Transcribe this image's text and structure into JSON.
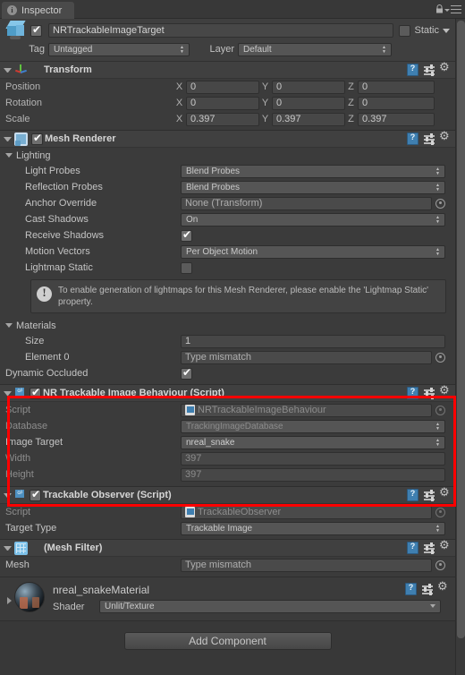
{
  "window": {
    "tab_label": "Inspector",
    "tab_icon": "info-icon",
    "lock_icon": "lock-icon",
    "menu_icon": "hamburger-menu-icon"
  },
  "object_header": {
    "icon": "cube-prefab-icon",
    "enabled": true,
    "name": "NRTrackableImageTarget",
    "static_label": "Static",
    "static_checked": false,
    "tag_label": "Tag",
    "tag_value": "Untagged",
    "layer_label": "Layer",
    "layer_value": "Default"
  },
  "components": [
    {
      "title": "Transform",
      "icon": "transform-axis-icon",
      "has_checkbox": false,
      "rows": [
        {
          "label": "Position",
          "x": "0",
          "y": "0",
          "z": "0"
        },
        {
          "label": "Rotation",
          "x": "0",
          "y": "0",
          "z": "0"
        },
        {
          "label": "Scale",
          "x": "0.397",
          "y": "0.397",
          "z": "0.397"
        }
      ],
      "axis_labels": {
        "x": "X",
        "y": "Y",
        "z": "Z"
      }
    },
    {
      "title": "Mesh Renderer",
      "icon": "mesh-renderer-icon",
      "has_checkbox": true,
      "checked": true,
      "lighting_label": "Lighting",
      "lighting_rows": [
        {
          "label": "Light Probes",
          "value": "Blend Probes",
          "kind": "popup"
        },
        {
          "label": "Reflection Probes",
          "value": "Blend Probes",
          "kind": "popup"
        },
        {
          "label": "Anchor Override",
          "value": "None (Transform)",
          "kind": "object"
        },
        {
          "label": "Cast Shadows",
          "value": "On",
          "kind": "popup"
        },
        {
          "label": "Receive Shadows",
          "value": "",
          "kind": "checkbox",
          "checked": true
        },
        {
          "label": "Motion Vectors",
          "value": "Per Object Motion",
          "kind": "popup"
        },
        {
          "label": "Lightmap Static",
          "value": "",
          "kind": "checkbox",
          "checked": false
        }
      ],
      "helpbox": "To enable generation of lightmaps for this Mesh Renderer, please enable the 'Lightmap Static' property.",
      "helpbox_icon": "warning-icon",
      "materials_label": "Materials",
      "material_rows": [
        {
          "label": "Size",
          "value": "1",
          "kind": "text"
        },
        {
          "label": "Element 0",
          "value": "Type mismatch",
          "kind": "object"
        }
      ],
      "dynamic_occluded": {
        "label": "Dynamic Occluded",
        "checked": true
      }
    },
    {
      "title": "NR Trackable Image Behaviour (Script)",
      "icon": "csharp-script-icon",
      "has_checkbox": true,
      "checked": true,
      "highlighted": true,
      "rows": [
        {
          "label": "Script",
          "value": "NRTrackableImageBehaviour",
          "kind": "script",
          "dim": true
        },
        {
          "label": "Database",
          "value": "TrackingImageDatabase",
          "kind": "popup",
          "dim": true
        },
        {
          "label": "Image Target",
          "value": "nreal_snake",
          "kind": "popup",
          "dim": false
        },
        {
          "label": "Width",
          "value": "397",
          "kind": "text",
          "dim": true
        },
        {
          "label": "Height",
          "value": "397",
          "kind": "text",
          "dim": true
        }
      ]
    },
    {
      "title": "Trackable Observer (Script)",
      "icon": "csharp-script-icon",
      "has_checkbox": true,
      "checked": true,
      "rows": [
        {
          "label": "Script",
          "value": "TrackableObserver",
          "kind": "script",
          "dim": true
        },
        {
          "label": "Target Type",
          "value": "Trackable Image",
          "kind": "popup",
          "dim": false
        }
      ]
    },
    {
      "title": "(Mesh Filter)",
      "icon": "mesh-filter-icon",
      "has_checkbox": false,
      "rows": [
        {
          "label": "Mesh",
          "value": "Type mismatch",
          "kind": "object",
          "dim": false
        }
      ]
    }
  ],
  "material": {
    "name": "nreal_snakeMaterial",
    "preview_icon": "material-sphere-preview",
    "shader_label": "Shader",
    "shader_value": "Unlit/Texture"
  },
  "footer": {
    "add_component_label": "Add Component"
  },
  "colors": {
    "background": "#383838",
    "panel": "#3b3b3b",
    "header": "#404040",
    "field": "#474747",
    "accent_red": "#ff0000",
    "text": "#c4c4c4",
    "text_dim": "#8c8c8c"
  }
}
